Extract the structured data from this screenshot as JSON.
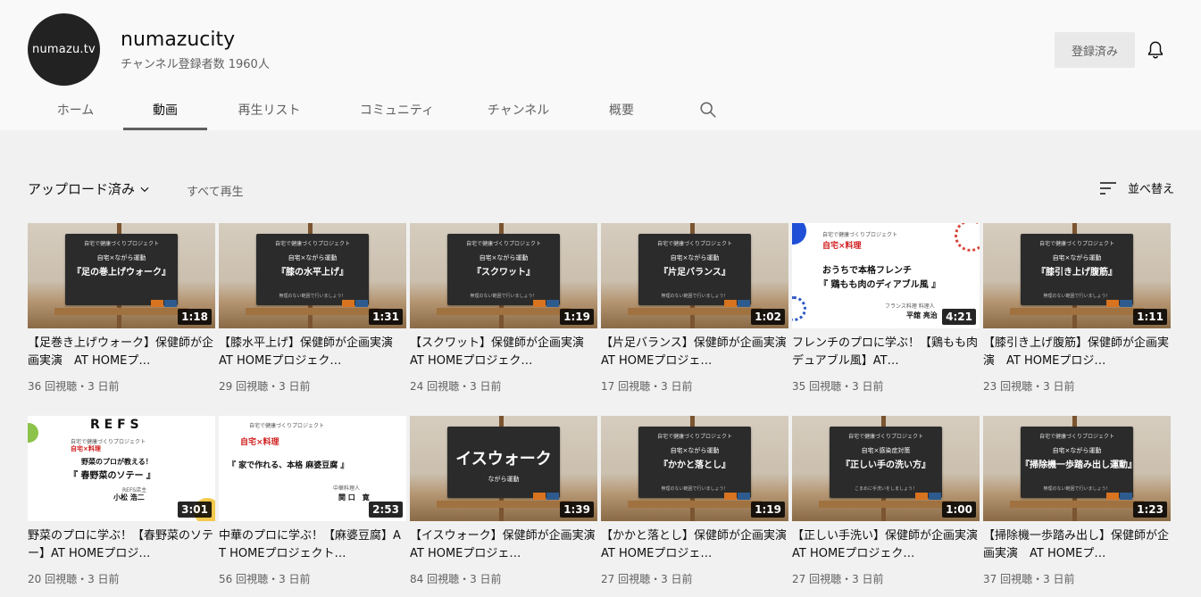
{
  "channel": {
    "avatar_text": "numazu.tv",
    "name": "numazucity",
    "subscribers": "チャンネル登録者数 1960人",
    "subscribe_label": "登録済み"
  },
  "tabs": [
    "ホーム",
    "動画",
    "再生リスト",
    "コミュニティ",
    "チャンネル",
    "概要"
  ],
  "active_tab": "動画",
  "sortbar": {
    "uploads_label": "アップロード済み",
    "play_all_label": "すべて再生",
    "sort_label": "並べ替え"
  },
  "videos": [
    {
      "thumb": {
        "style": "board",
        "line1": "自宅で健康づくりプロジェクト",
        "line2": "自宅×ながら運動",
        "line3": "『足の巻上げウォーク』",
        "line4": ""
      },
      "duration": "1:18",
      "title": "【足巻き上げウォーク】保健師が企画実演　AT HOMEプ…",
      "meta": "36 回視聴・3 日前"
    },
    {
      "thumb": {
        "style": "board",
        "line1": "自宅で健康づくりプロジェクト",
        "line2": "自宅×ながら運動",
        "line3": "『膝の水平上げ』",
        "line4": "無理のない範囲で行いましょう！"
      },
      "duration": "1:31",
      "title": "【膝水平上げ】保健師が企画実演　AT HOMEプロジェク…",
      "meta": "29 回視聴・3 日前"
    },
    {
      "thumb": {
        "style": "board",
        "line1": "自宅で健康づくりプロジェクト",
        "line2": "自宅×ながら運動",
        "line3": "『スクワット』",
        "line4": "無理のない範囲で行いましょう！"
      },
      "duration": "1:19",
      "title": "【スクワット】保健師が企画実演　AT HOMEプロジェク…",
      "meta": "24 回視聴・3 日前"
    },
    {
      "thumb": {
        "style": "board",
        "line1": "自宅で健康づくりプロジェクト",
        "line2": "自宅×ながら運動",
        "line3": "『片足バランス』",
        "line4": "無理のない範囲で行いましょう！"
      },
      "duration": "1:02",
      "title": "【片足バランス】保健師が企画実演　AT HOMEプロジェ…",
      "meta": "17 回視聴・3 日前"
    },
    {
      "thumb": {
        "style": "white-french",
        "line1": "自宅で健康づくりプロジェクト",
        "line2": "自宅×料理",
        "line3": "おうちで本格フレンチ",
        "line4": "『 鶏もも肉のディアブル風 』",
        "line5": "フランス料理 料理人",
        "line6": "平舘 亮治"
      },
      "duration": "4:21",
      "title": "フレンチのプロに学ぶ！【鶏もも肉デュアブル風】AT…",
      "meta": "35 回視聴・3 日前"
    },
    {
      "thumb": {
        "style": "board",
        "line1": "自宅で健康づくりプロジェクト",
        "line2": "自宅×ながら運動",
        "line3": "『膝引き上げ腹筋』",
        "line4": "無理のない範囲で行いましょう！"
      },
      "duration": "1:11",
      "title": "【膝引き上げ腹筋】保健師が企画実演　AT HOMEプロジ…",
      "meta": "23 回視聴・3 日前"
    },
    {
      "thumb": {
        "style": "white-refs",
        "brand": "R E F S",
        "line1": "自宅で健康づくりプロジェクト",
        "line2": "自宅×料理",
        "line3": "野菜のプロが教える！",
        "line4": "『 春野菜のソテー 』",
        "line5": "REFS店主",
        "line6": "小松 浩二"
      },
      "duration": "3:01",
      "title": "野菜のプロに学ぶ！【春野菜のソテー】AT HOMEプロジ…",
      "meta": "20 回視聴・3 日前"
    },
    {
      "thumb": {
        "style": "white-chinese",
        "line1": "自宅で健康づくりプロジェクト",
        "line2": "自宅×料理",
        "line3": "『 家で作れる、本格 麻婆豆腐 』",
        "line5": "中華料理人",
        "line6": "関 口　寛"
      },
      "duration": "2:53",
      "title": "中華のプロに学ぶ！【麻婆豆腐】AT HOMEプロジェクト…",
      "meta": "56 回視聴・3 日前"
    },
    {
      "thumb": {
        "style": "board-big",
        "line1": "",
        "line2": "",
        "line3": "イスウォーク",
        "line4": "ながら運動"
      },
      "duration": "1:39",
      "title": "【イスウォーク】保健師が企画実演　AT HOMEプロジェ…",
      "meta": "84 回視聴・3 日前"
    },
    {
      "thumb": {
        "style": "board",
        "line1": "自宅で健康づくりプロジェクト",
        "line2": "自宅×ながら運動",
        "line3": "『かかと落とし』",
        "line4": "無理のない範囲で行いましょう！"
      },
      "duration": "1:19",
      "title": "【かかと落とし】保健師が企画実演　AT HOMEプロジェ…",
      "meta": "27 回視聴・3 日前"
    },
    {
      "thumb": {
        "style": "board",
        "line1": "自宅で健康づくりプロジェクト",
        "line2": "自宅×感染症対策",
        "line3": "『正しい手の洗い方』",
        "line4": "こまめに手洗いをしましょう！"
      },
      "duration": "1:00",
      "title": "【正しい手洗い】保健師が企画実演AT HOMEプロジェク…",
      "meta": "27 回視聴・3 日前"
    },
    {
      "thumb": {
        "style": "board",
        "line1": "自宅で健康づくりプロジェクト",
        "line2": "自宅×ながら運動",
        "line3": "『掃除機一歩踏み出し運動』",
        "line4": "無理のない範囲で行いましょう！"
      },
      "duration": "1:23",
      "title": "【掃除機一歩踏み出し】保健師が企画実演　AT HOMEプ…",
      "meta": "37 回視聴・3 日前"
    }
  ]
}
